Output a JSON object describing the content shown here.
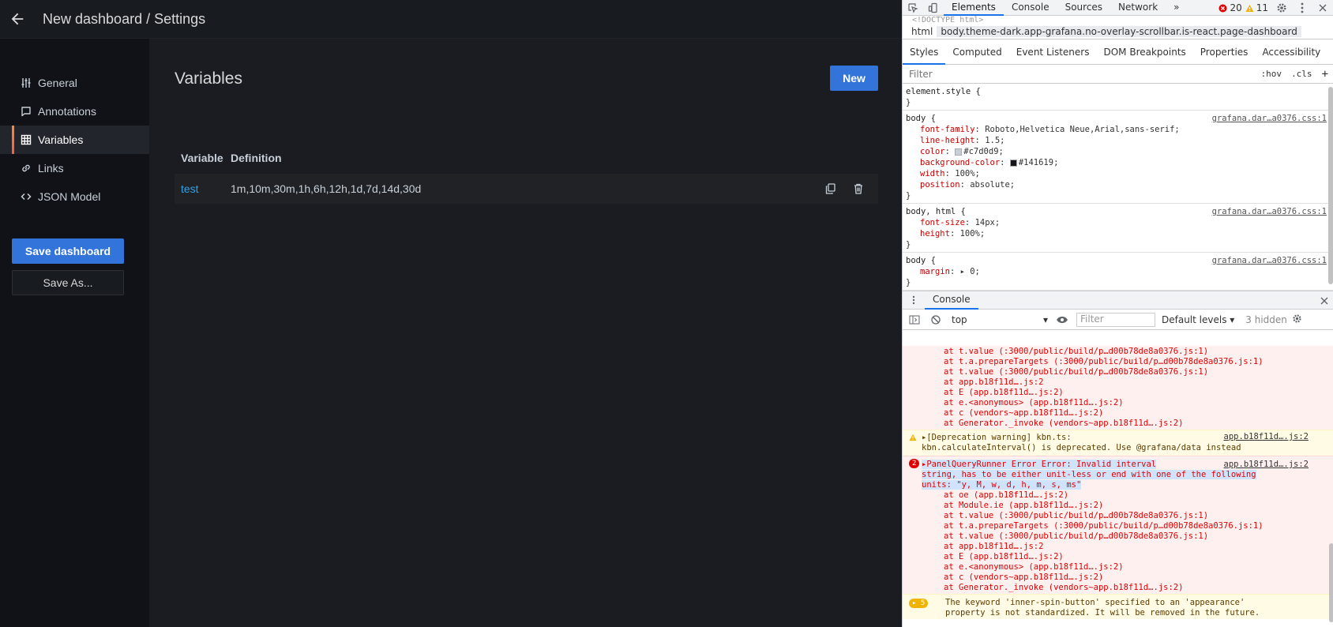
{
  "app": {
    "page_title": "New dashboard / Settings",
    "nav": [
      {
        "label": "General",
        "icon": "sliders-icon"
      },
      {
        "label": "Annotations",
        "icon": "comment-icon"
      },
      {
        "label": "Variables",
        "icon": "grid-icon",
        "active": true
      },
      {
        "label": "Links",
        "icon": "link-icon"
      },
      {
        "label": "JSON Model",
        "icon": "code-icon"
      }
    ],
    "save_dashboard": "Save dashboard",
    "save_as": "Save As...",
    "section_title": "Variables",
    "new_button": "New",
    "table": {
      "col_variable": "Variable",
      "col_definition": "Definition",
      "rows": [
        {
          "name": "test",
          "definition": "1m,10m,30m,1h,6h,12h,1d,7d,14d,30d"
        }
      ]
    },
    "colors": {
      "accent": "#3274d9",
      "link": "#33a2e5",
      "active_bar": "#f55f3e"
    }
  },
  "devtools": {
    "tabs": [
      "Elements",
      "Console",
      "Sources",
      "Network"
    ],
    "more": "»",
    "error_count": "20",
    "warning_count": "11",
    "doctype": "<!DOCTYPE html>",
    "crumb_html": "html",
    "crumb_body": "body.theme-dark.app-grafana.no-overlay-scrollbar.is-react.page-dashboard",
    "subtabs": [
      "Styles",
      "Computed",
      "Event Listeners",
      "DOM Breakpoints",
      "Properties",
      "Accessibility"
    ],
    "filter_placeholder": "Filter",
    "hov": ":hov",
    "cls": ".cls",
    "plus": "+",
    "rules": {
      "element_style": "element.style {",
      "close": "}",
      "src": "grafana.dar…a0376.css:1",
      "body_sel": "body {",
      "body_html_sel": "body, html {",
      "r1": [
        {
          "p": "font-family",
          "v": "Roboto,Helvetica Neue,Arial,sans-serif;"
        },
        {
          "p": "line-height",
          "v": "1.5;"
        },
        {
          "p": "color",
          "v": "#c7d0d9;"
        },
        {
          "p": "background-color",
          "v": "#141619;"
        },
        {
          "p": "width",
          "v": "100%;"
        },
        {
          "p": "position",
          "v": "absolute;"
        }
      ],
      "r2": [
        {
          "p": "font-size",
          "v": "14px;"
        },
        {
          "p": "height",
          "v": "100%;"
        }
      ],
      "r3": [
        {
          "p": "margin",
          "v": "▸ 0;"
        }
      ]
    },
    "drawer_tab": "Console",
    "console_context": "top",
    "console_filter": "Filter",
    "default_levels": "Default levels ▾",
    "hidden": "3 hidden",
    "stack1": [
      "at t.value (:3000/public/build/p…d00b78de8a0376.js:1)",
      "at t.a.prepareTargets (:3000/public/build/p…d00b78de8a0376.js:1)",
      "at t.value (:3000/public/build/p…d00b78de8a0376.js:1)",
      "at app.b18f11d….js:2",
      "at E (app.b18f11d….js:2)",
      "at e.<anonymous> (app.b18f11d….js:2)",
      "at c (vendors~app.b18f11d….js:2)",
      "at Generator._invoke (vendors~app.b18f11d….js:2)"
    ],
    "warn_msg_1": "▸[Deprecation warning] kbn.ts:",
    "warn_msg_2": "kbn.calculateInterval() is deprecated. Use @grafana/data instead",
    "warn_loc": "app.b18f11d….js:2",
    "err_badge": "2",
    "err_msg_1": "▸PanelQueryRunner Error Error: Invalid interval",
    "err_msg_2": "string, has to be either unit-less or end with one of the following",
    "err_msg_3": "units: \"y, M, w, d, h, m, s, ms\"",
    "err_loc": "app.b18f11d….js:2",
    "stack2": [
      "at oe (app.b18f11d….js:2)",
      "at Module.ie (app.b18f11d….js:2)",
      "at t.value (:3000/public/build/p…d00b78de8a0376.js:1)",
      "at t.a.prepareTargets (:3000/public/build/p…d00b78de8a0376.js:1)",
      "at t.value (:3000/public/build/p…d00b78de8a0376.js:1)",
      "at app.b18f11d….js:2",
      "at E (app.b18f11d….js:2)",
      "at e.<anonymous> (app.b18f11d….js:2)",
      "at c (vendors~app.b18f11d….js:2)",
      "at Generator._invoke (vendors~app.b18f11d….js:2)"
    ],
    "warn2_badge": "▸ 5",
    "warn2_msg_1": "The keyword 'inner-spin-button' specified to an 'appearance'",
    "warn2_msg_2": "property is not standardized. It will be removed in the future."
  }
}
